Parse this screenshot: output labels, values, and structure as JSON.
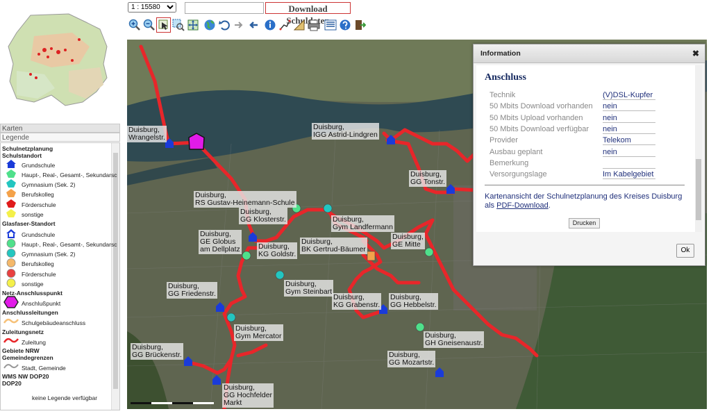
{
  "scale": {
    "selected": "1 : 15580"
  },
  "search": {
    "value": ""
  },
  "download_button": "Download Schuldaten",
  "left_panel": {
    "karten_tab": "Karten",
    "legende_tab": "Legende",
    "groups": [
      "Schulnetzplanung",
      "Schulstandort",
      "Glasfaser-Standort",
      "Netz-Anschlusspunkt",
      "Anschlussleitungen",
      "Zuleitungsnetz",
      "Gebiete NRW",
      "Gemeindegrenzen",
      "WMS NW DOP20",
      "DOP20"
    ],
    "schulstandort_items": [
      "Grundschule",
      "Haupt-, Real-, Gesamt-, Sekundarsc",
      "Gymnasium (Sek. 2)",
      "Berufskolleg",
      "Förderschule",
      "sonstige"
    ],
    "glasfaser_items": [
      "Grundschule",
      "Haupt-, Real-, Gesamt-, Sekundarsc",
      "Gymnasium (Sek. 2)",
      "Berufskolleg",
      "Förderschule",
      "sonstige"
    ],
    "anschlusspunkt_item": "Anschlußpunkt",
    "schulgebaeude_item": "Schulgebäudeanschluss",
    "zuleitung_item": "Zuleitung",
    "gemeinde_item": "Stadt, Gemeinde",
    "no_legend": "keine Legende verfügbar"
  },
  "map_labels": [
    "Duisburg,\nWrangelstr.",
    "Duisburg,\nIGG Astrid-Lindgren",
    "Duisburg,\nGG Tonstr.",
    "Duisburg,\nRS Gustav-Heinemann-Schule",
    "Duisburg,\nGG Klosterstr.",
    "Duisburg,\nGym Landfermann",
    "Duisburg,\nGE Globus\nam Dellplatz",
    "Duisburg,\nKG Goldstr.",
    "Duisburg,\nBK Gertrud-Bäumer",
    "Duisburg,\nGE Mitte",
    "Duisburg,\nGym Steinbart",
    "Duisburg,\nGG Friedenstr.",
    "Duisburg,\nKG Grabenstr.",
    "Duisburg,\nGG Hebbelstr.",
    "Duisburg,\nGym Mercator",
    "Duisburg,\nGH Gneisenaustr.",
    "Duisburg,\nGG Brückenstr.",
    "Duisburg,\nGG Mozartstr.",
    "Duisburg,\nGG Hochfelder\nMarkt"
  ],
  "dialog": {
    "title": "Information",
    "heading": "Anschluss",
    "rows": [
      {
        "key": "Technik",
        "value": "(V)DSL-Kupfer"
      },
      {
        "key": "50 Mbits Download vorhanden",
        "value": "nein"
      },
      {
        "key": "50 Mbits Upload vorhanden",
        "value": "nein"
      },
      {
        "key": "50 Mbits Download verfügbar",
        "value": "nein"
      },
      {
        "key": "Provider",
        "value": "Telekom"
      },
      {
        "key": "Ausbau geplant",
        "value": "nein"
      },
      {
        "key": "Bemerkung",
        "value": ""
      },
      {
        "key": "Versorgungslage",
        "value": "Im Kabelgebiet"
      }
    ],
    "note_prefix": "Kartenansicht der Schulnetzplanung des Kreises Duisburg als ",
    "note_link": "PDF-Download",
    "note_suffix": ".",
    "print_button": "Drucken",
    "ok_button": "Ok"
  },
  "colors": {
    "route": "#e8262a",
    "dialog_text": "#1f2f7a",
    "download_border": "#cc3333"
  }
}
